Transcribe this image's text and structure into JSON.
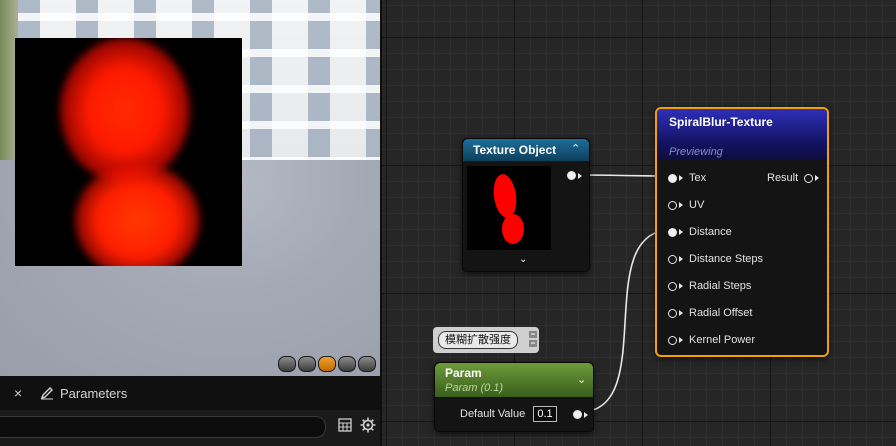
{
  "params_panel": {
    "close_glyph": "×",
    "tab_label": "Parameters",
    "search_placeholder": ""
  },
  "nodes": {
    "texture_object": {
      "title": "Texture Object",
      "collapse_glyph": "⌃",
      "expand_glyph": "⌄"
    },
    "spiral_blur": {
      "title": "SpiralBlur-Texture",
      "subtitle": "Previewing",
      "inputs": [
        "Tex",
        "UV",
        "Distance",
        "Distance Steps",
        "Radial Steps",
        "Radial Offset",
        "Kernel Power"
      ],
      "output": "Result"
    },
    "param": {
      "title": "Param",
      "subtitle": "Param (0.1)",
      "default_label": "Default Value",
      "default_value": "0.1",
      "collapse_glyph": "⌄"
    }
  },
  "comment": {
    "text": "模糊扩散强度"
  },
  "colors": {
    "accent_selected": "#f5a000",
    "texture_header": "#1b6e9a",
    "spiral_header": "#2e2fb8",
    "param_header": "#6c9b3a"
  }
}
